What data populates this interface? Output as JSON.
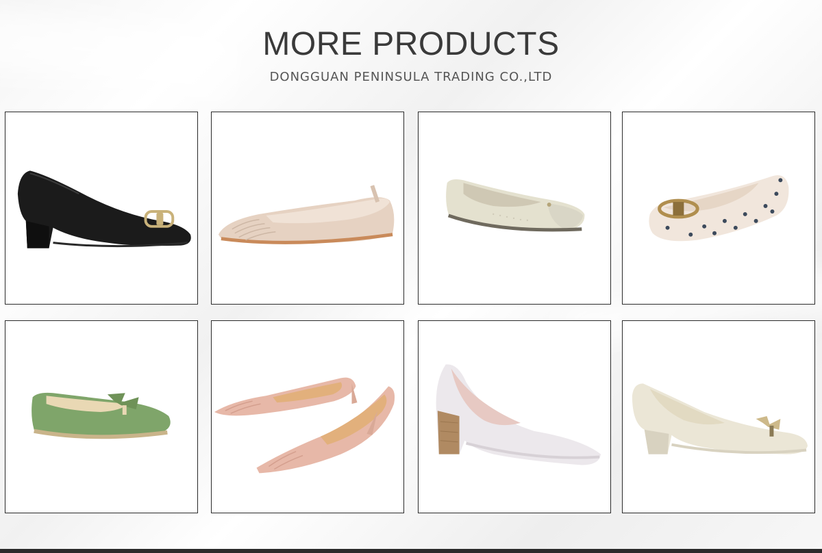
{
  "header": {
    "title": "MORE PRODUCTS",
    "subtitle": "DONGGUAN PENINSULA TRADING CO.,LTD"
  },
  "products": [
    {
      "icon": "black-block-heel-pump-icon",
      "colors": {
        "upper": "#1b1b1b",
        "sole": "#111111",
        "buckle": "#c9b27a"
      }
    },
    {
      "icon": "nude-ruched-ballet-flat-icon",
      "colors": {
        "upper": "#e6d2c2",
        "sole": "#c98a5a",
        "lining": "#f0e2d6"
      }
    },
    {
      "icon": "cream-perforated-flat-icon",
      "colors": {
        "upper": "#e4e1cf",
        "sole": "#6f6a5e",
        "lining": "#cfc8b4"
      }
    },
    {
      "icon": "bow-print-ballet-flat-icon",
      "colors": {
        "upper": "#f1e6dc",
        "print": "#3c4a5c",
        "buckle": "#b08e4e"
      }
    },
    {
      "icon": "green-bow-loafer-icon",
      "colors": {
        "upper": "#7fa56a",
        "trim": "#e9d8b4",
        "sole": "#c9b48a"
      }
    },
    {
      "icon": "pink-pleated-kitten-heel-pair-icon",
      "colors": {
        "upper": "#e7b8a8",
        "lining": "#e2b07c",
        "heel": "#d9a997"
      }
    },
    {
      "icon": "white-patent-block-heel-pump-icon",
      "colors": {
        "upper": "#ece8ec",
        "heel": "#b08a62",
        "lining": "#e7c9c3"
      }
    },
    {
      "icon": "ivory-bow-block-heel-pump-icon",
      "colors": {
        "upper": "#ebe6d6",
        "sole": "#d8d2c0",
        "bow": "#cdb98a"
      }
    }
  ]
}
